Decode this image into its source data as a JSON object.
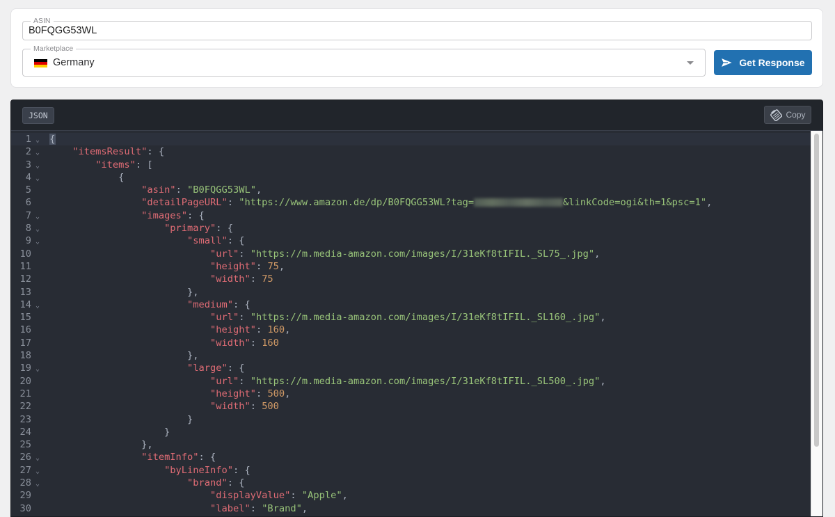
{
  "form": {
    "asin_label": "ASIN",
    "asin_value": "B0FQGG53WL",
    "marketplace_label": "Marketplace",
    "marketplace_value": "Germany",
    "marketplace_flag": [
      "#000000",
      "#dd0000",
      "#ffce00"
    ],
    "submit_label": "Get Response",
    "accent": "#2271b1"
  },
  "editor": {
    "format_tag": "JSON",
    "copy_label": "Copy",
    "redacted_after": "tag=",
    "fold_lines": [
      1,
      2,
      3,
      4,
      7,
      8,
      9,
      14,
      19,
      26,
      27,
      28
    ],
    "lines": [
      "{",
      "    \"itemsResult\": {",
      "        \"items\": [",
      "            {",
      "                \"asin\": \"B0FQGG53WL\",",
      "                \"detailPageURL\": \"https://www.amazon.de/dp/B0FQGG53WL?tag=&linkCode=ogi&th=1&psc=1\",",
      "                \"images\": {",
      "                    \"primary\": {",
      "                        \"small\": {",
      "                            \"url\": \"https://m.media-amazon.com/images/I/31eKf8tIFIL._SL75_.jpg\",",
      "                            \"height\": 75,",
      "                            \"width\": 75",
      "                        },",
      "                        \"medium\": {",
      "                            \"url\": \"https://m.media-amazon.com/images/I/31eKf8tIFIL._SL160_.jpg\",",
      "                            \"height\": 160,",
      "                            \"width\": 160",
      "                        },",
      "                        \"large\": {",
      "                            \"url\": \"https://m.media-amazon.com/images/I/31eKf8tIFIL._SL500_.jpg\",",
      "                            \"height\": 500,",
      "                            \"width\": 500",
      "                        }",
      "                    }",
      "                },",
      "                \"itemInfo\": {",
      "                    \"byLineInfo\": {",
      "                        \"brand\": {",
      "                            \"displayValue\": \"Apple\",",
      "                            \"label\": \"Brand\","
    ]
  }
}
